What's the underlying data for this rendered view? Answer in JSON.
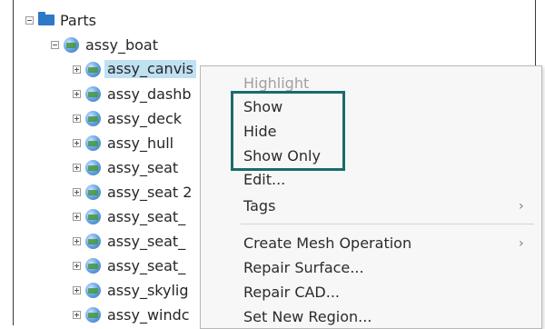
{
  "tree": {
    "root": {
      "label": "Parts"
    },
    "assembly": {
      "label": "assy_boat"
    },
    "children": [
      "assy_canvis",
      "assy_dashb",
      "assy_deck",
      "assy_hull",
      "assy_seat",
      "assy_seat 2",
      "assy_seat_",
      "assy_seat_",
      "assy_seat_",
      "assy_skylig",
      "assy_windc"
    ]
  },
  "context_menu": {
    "highlight": "Highlight",
    "show": "Show",
    "hide": "Hide",
    "show_only": "Show Only",
    "edit": "Edit...",
    "tags": "Tags",
    "create_mesh_operation": "Create Mesh Operation",
    "repair_surface": "Repair Surface...",
    "repair_cad": "Repair CAD...",
    "set_new_region": "Set New Region...",
    "submenu_arrow": "›"
  },
  "colors": {
    "selection": "#bfe1f2",
    "callout_box": "#1a6b6d",
    "folder": "#2f78c6"
  }
}
